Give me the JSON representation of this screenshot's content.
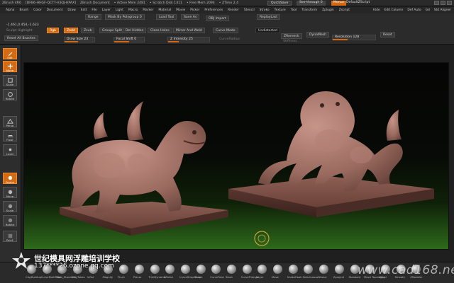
{
  "titlebar": {
    "app": "ZBrush 4R6",
    "doc_id": "[DFB6-HHGF-QCTT-H3QJ-HPAX]",
    "doc": "ZBrush Document",
    "mem1": "• Active Mem 2481",
    "mem2": "• Scratch Disk 1411",
    "mem3": "• Free Mem 2094",
    "mem4": "• ZTime 2.4",
    "quicksave": "QuickSave",
    "seethrough": "See-through 0",
    "menus": "Menus",
    "script": "DefaultZScript"
  },
  "menubar": [
    "Alpha",
    "Brush",
    "Color",
    "Document",
    "Draw",
    "Edit",
    "File",
    "Layer",
    "Light",
    "Macro",
    "Marker",
    "Material",
    "Movie",
    "Picker",
    "Preferences",
    "Render",
    "Stencil",
    "Stroke",
    "Texture",
    "Tool",
    "Transform",
    "Zplugin",
    "Zscript"
  ],
  "menubar_right": [
    "Hide",
    "Edit Column",
    "Def Auto",
    "Gd",
    "Std Aligner"
  ],
  "toolbar": {
    "coords": "-1.461,0.454,-1.623",
    "sculpt_label": "Sculpt Highlight",
    "rgb": "Rgb",
    "zadd": "Zadd",
    "zsub": "Zsub",
    "draw_size": "Draw Size 23",
    "range": "Range",
    "mask_by_poly": "Mask By Polygroup 0",
    "groups_split": "Groups Split",
    "del_hidden": "Del Hidden",
    "close_holes": "Close Holes",
    "focal_shift": "Focal Shift 0",
    "load_tool": "Load Tool",
    "save_as": "Save As",
    "mirror_weld": "Mirror And Weld",
    "curve_mode": "Curve Mode",
    "z_intensity": "Z Intensity 25",
    "obj_import": "OBJ Import",
    "replaylast": "ReplayLast",
    "undistorted": "Undistorted",
    "curve_radius": "CurveRadius",
    "stiffness": "Stiffness",
    "zremesh": "ZRemesh",
    "dynamesh": "DynaMesh",
    "resolution": "Resolution 128",
    "reset": "Reset",
    "reset_all": "Reset All Brushes",
    "draw_size_fill": 0.45,
    "focal_fill": 0.5,
    "z_int_fill": 0.25,
    "res_fill": 0.35
  },
  "leftshelf": [
    "Edit",
    "Move",
    "Scale",
    "Rotate",
    "Draw",
    "Persp",
    "Floor",
    "Local",
    "LSym",
    "Xpose",
    "Frame",
    "Move",
    "Scale",
    "Rotate",
    "PolyF",
    "Transp",
    "Solo",
    "Ghost",
    "Xpose"
  ],
  "bottombar": [
    "ClayBuildup",
    "CurveMultiTube",
    "Dam_Standard",
    "ClayTubes",
    "Inflat",
    "Magnify",
    "Pinch",
    "Planar",
    "TrimDynamic",
    "hPolish",
    "CurveStrapSnap",
    "Curve",
    "CurveTube",
    "Slash",
    "CurveTriangle",
    "Layer",
    "Move",
    "SnakeHook",
    "SelectLasso",
    "Weave",
    "Zproject",
    "Standard",
    "Move Topological",
    "Clay",
    "Smooth",
    "ZModeler"
  ],
  "watermark": {
    "cn_title": "世纪模具网浮雕培训学校",
    "contact": "137****26.ozone.qq.com",
    "site": "www.cad168.net"
  },
  "colors": {
    "accent": "#d36a14",
    "panel": "#2b2b2b",
    "model": "#a07066"
  }
}
